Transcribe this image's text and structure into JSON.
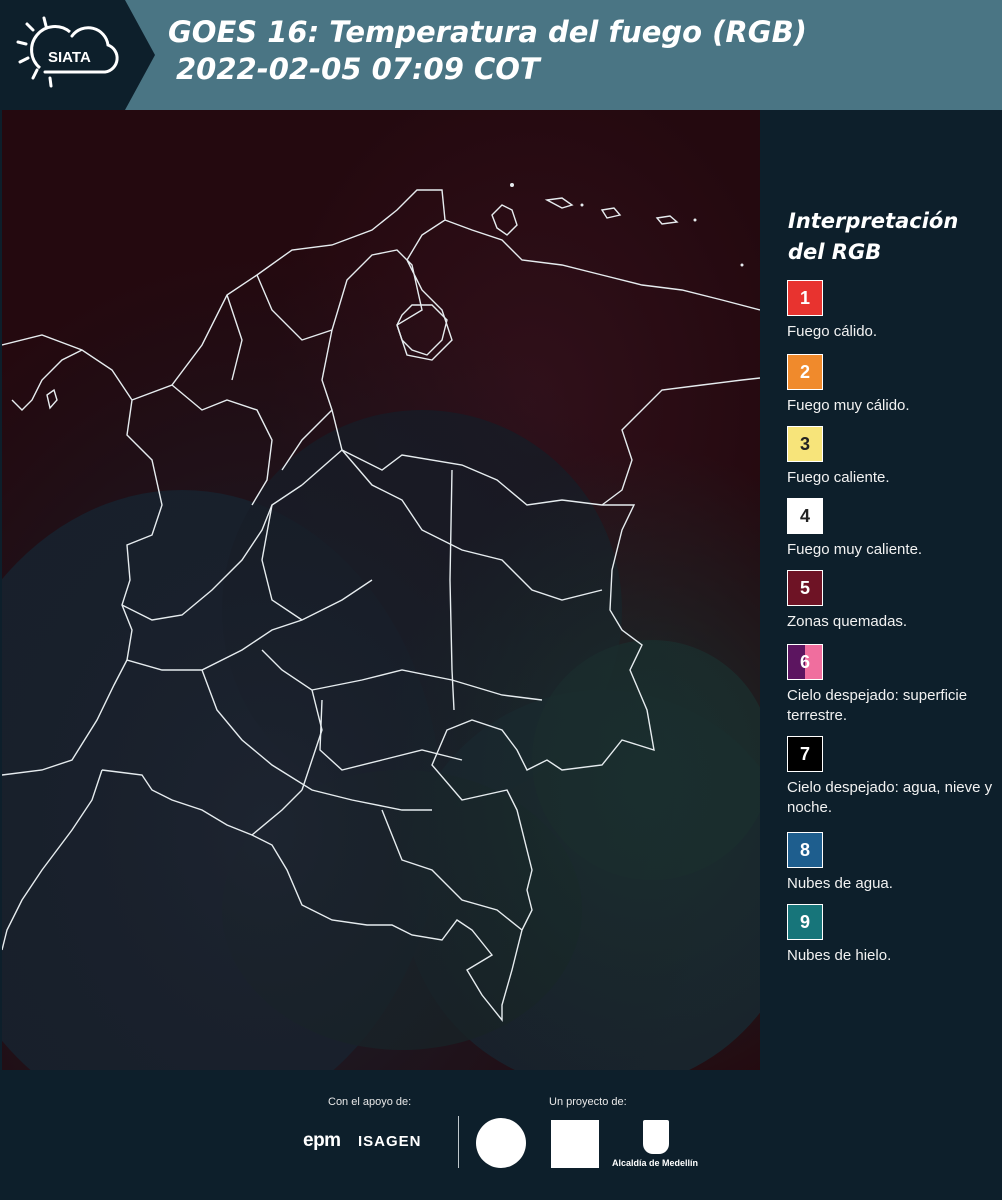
{
  "header": {
    "logo_text": "SIATA",
    "title_line1": "GOES 16: Temperatura del fuego (RGB)",
    "title_line2": "2022-02-05 07:09 COT"
  },
  "legend": {
    "title": "Interpretación del RGB",
    "items": [
      {
        "number": "1",
        "label": "Fuego cálido.",
        "color": "#e8332f"
      },
      {
        "number": "2",
        "label": "Fuego muy cálido.",
        "color": "#f08a2c"
      },
      {
        "number": "3",
        "label": "Fuego caliente.",
        "color": "#f7e47a"
      },
      {
        "number": "4",
        "label": "Fuego muy caliente.",
        "color": "#ffffff"
      },
      {
        "number": "5",
        "label": "Zonas quemadas.",
        "color": "#6e1325"
      },
      {
        "number": "6",
        "label": "Cielo despejado: superficie terrestre.",
        "color": "#5c1560",
        "color2": "#f06e9e"
      },
      {
        "number": "7",
        "label": "Cielo despejado: agua, nieve y noche.",
        "color": "#000000"
      },
      {
        "number": "8",
        "label": "Nubes de agua.",
        "color": "#1e5e8e"
      },
      {
        "number": "9",
        "label": "Nubes de hielo.",
        "color": "#17757a"
      }
    ]
  },
  "footer": {
    "support_label": "Con el apoyo de:",
    "project_label": "Un proyecto de:",
    "sponsors": [
      "epm",
      "ISAGEN"
    ],
    "partners": [
      "Alcaldía de Medellín"
    ]
  },
  "colors": {
    "header_bg": "#4a7584",
    "page_bg": "#0d1f2b",
    "map_land": "#141a24",
    "map_red": "#2a0b12"
  }
}
